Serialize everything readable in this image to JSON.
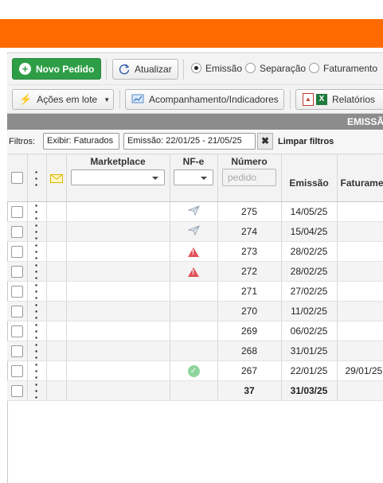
{
  "toolbar": {
    "new_order_label": "Novo Pedido",
    "refresh_label": "Atualizar",
    "radios": [
      {
        "label": "Emissão",
        "selected": true
      },
      {
        "label": "Separação",
        "selected": false
      },
      {
        "label": "Faturamento",
        "selected": false
      }
    ],
    "bulk_actions_label": "Ações em lote",
    "tracking_label": "Acompanhamento/Indicadores",
    "reports_label": "Relatórios"
  },
  "section_header": "EMISSÃ",
  "filters": {
    "label": "Filtros:",
    "chips": [
      "Exibir: Faturados",
      "Emissão: 22/01/25 - 21/05/25"
    ],
    "clear_label": "Limpar filtros"
  },
  "table": {
    "headers": {
      "marketplace": "Marketplace",
      "nfe": "NF-e",
      "numero": "Número",
      "numero_placeholder": "pedido",
      "emissao": "Emissão",
      "faturamento": "Faturame"
    },
    "rows": [
      {
        "nfe_icon": "paper-plane-icon",
        "numero": "275",
        "emissao": "14/05/25",
        "faturamento": ""
      },
      {
        "nfe_icon": "paper-plane-icon",
        "numero": "274",
        "emissao": "15/04/25",
        "faturamento": ""
      },
      {
        "nfe_icon": "warning-icon",
        "numero": "273",
        "emissao": "28/02/25",
        "faturamento": ""
      },
      {
        "nfe_icon": "warning-icon",
        "numero": "272",
        "emissao": "28/02/25",
        "faturamento": ""
      },
      {
        "nfe_icon": "",
        "numero": "271",
        "emissao": "27/02/25",
        "faturamento": ""
      },
      {
        "nfe_icon": "",
        "numero": "270",
        "emissao": "11/02/25",
        "faturamento": ""
      },
      {
        "nfe_icon": "",
        "numero": "269",
        "emissao": "06/02/25",
        "faturamento": ""
      },
      {
        "nfe_icon": "",
        "numero": "268",
        "emissao": "31/01/25",
        "faturamento": ""
      },
      {
        "nfe_icon": "check-icon",
        "numero": "267",
        "emissao": "22/01/25",
        "faturamento": "29/01/25"
      }
    ],
    "totals": {
      "numero": "37",
      "emissao": "31/03/25"
    }
  },
  "colors": {
    "brand": "#ff6a00",
    "primary_button": "#2e9e46"
  }
}
